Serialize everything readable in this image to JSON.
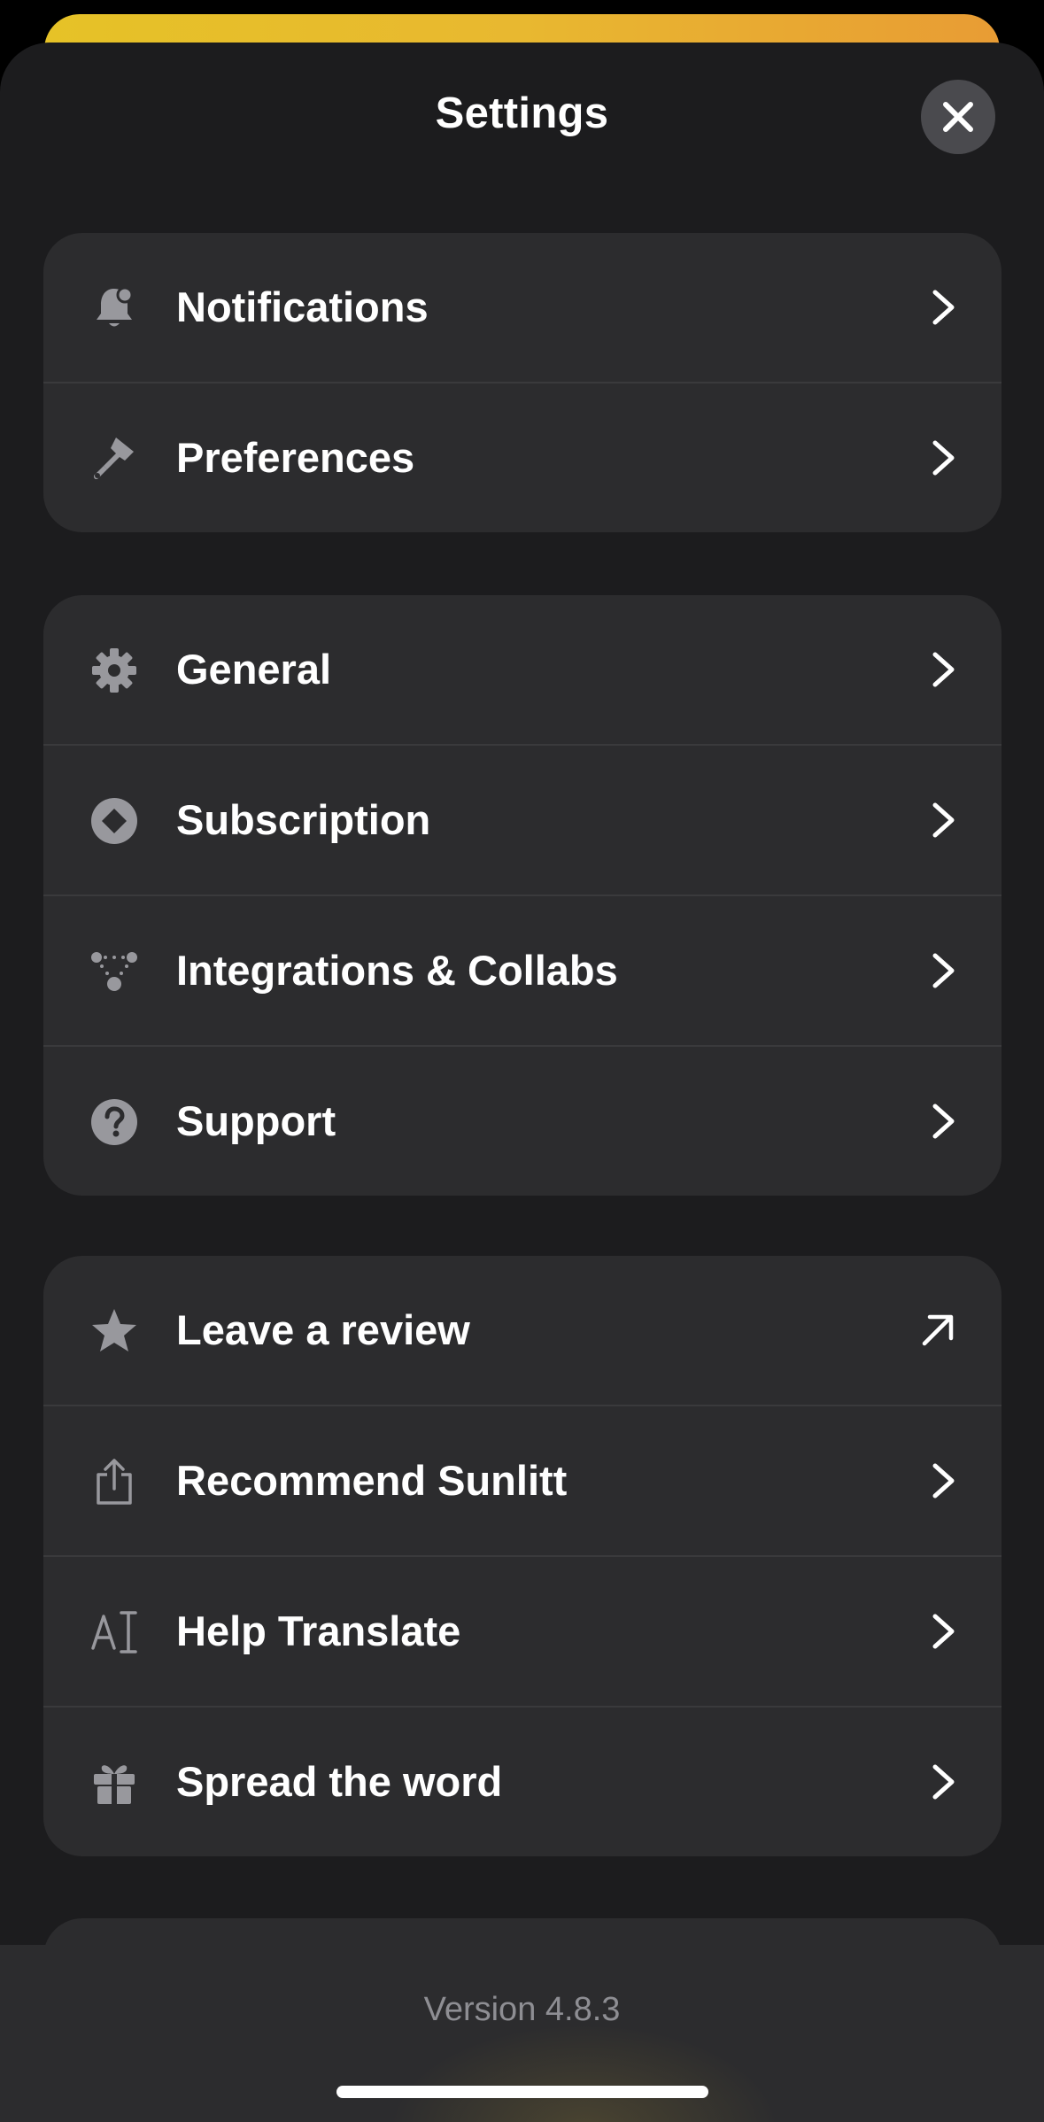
{
  "header": {
    "title": "Settings",
    "close_icon": "close-icon"
  },
  "groups": [
    {
      "rows": [
        {
          "label": "Notifications",
          "icon": "bell-icon",
          "action": "chevron-right-icon"
        },
        {
          "label": "Preferences",
          "icon": "brush-icon",
          "action": "chevron-right-icon"
        }
      ]
    },
    {
      "rows": [
        {
          "label": "General",
          "icon": "gear-icon",
          "action": "chevron-right-icon"
        },
        {
          "label": "Subscription",
          "icon": "diamond-circle-icon",
          "action": "chevron-right-icon"
        },
        {
          "label": "Integrations & Collabs",
          "icon": "nodes-icon",
          "action": "chevron-right-icon"
        },
        {
          "label": "Support",
          "icon": "question-circle-icon",
          "action": "chevron-right-icon"
        }
      ]
    },
    {
      "rows": [
        {
          "label": "Leave a review",
          "icon": "star-icon",
          "action": "external-arrow-icon"
        },
        {
          "label": "Recommend Sunlitt",
          "icon": "share-icon",
          "action": "chevron-right-icon"
        },
        {
          "label": "Help Translate",
          "icon": "translate-icon",
          "action": "chevron-right-icon"
        },
        {
          "label": "Spread the word",
          "icon": "gift-icon",
          "action": "chevron-right-icon"
        }
      ]
    }
  ],
  "footer": {
    "version": "Version 4.8.3"
  },
  "colors": {
    "sheet_bg": "#1c1c1e",
    "group_bg": "#2c2c2e",
    "icon_gray": "#98989d",
    "accent_yellow": "#e6c227"
  }
}
